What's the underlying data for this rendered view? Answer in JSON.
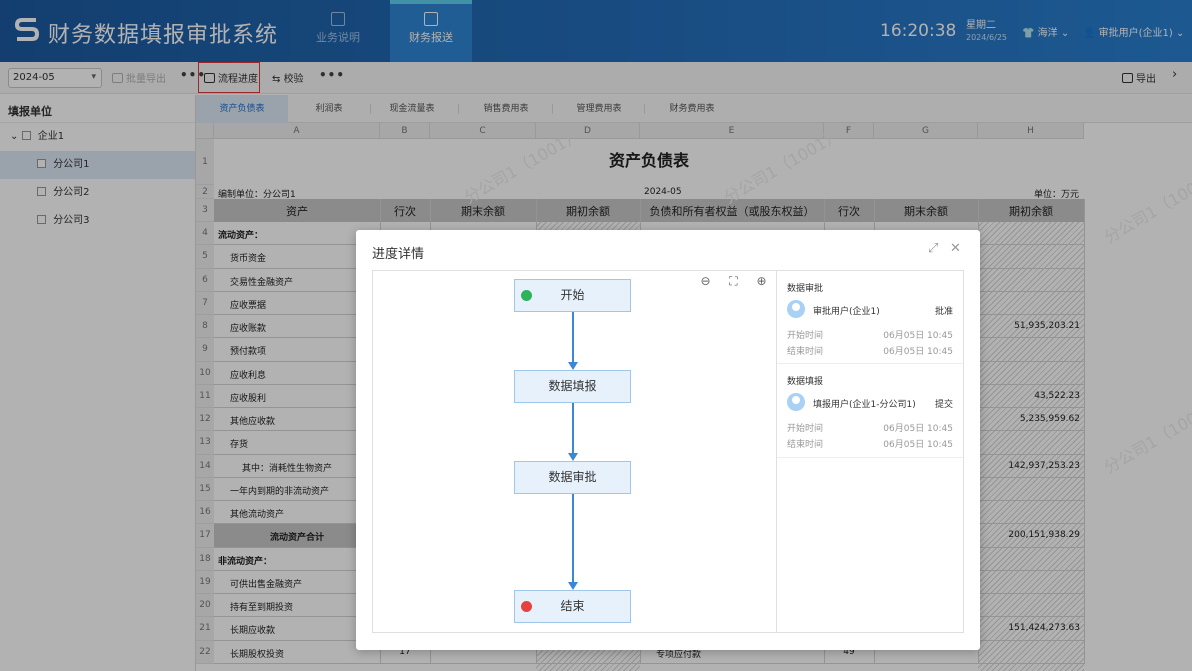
{
  "header": {
    "title": "财务数据填报审批系统",
    "nav": [
      "业务说明",
      "财务报送"
    ],
    "clock": "16:20:38",
    "weekday": "星期二",
    "date": "2024/6/25",
    "theme_label": "海洋",
    "user": "审批用户(企业1)",
    "brand_color": "#1c5aa0"
  },
  "toolbar": {
    "period": "2024-05",
    "batch_export": "批量导出",
    "flow_progress": "流程进度",
    "check": "校验",
    "export": "导出"
  },
  "sidebar": {
    "title": "填报单位",
    "items": [
      {
        "label": "企业1"
      },
      {
        "label": "分公司1"
      },
      {
        "label": "分公司2"
      },
      {
        "label": "分公司3"
      }
    ]
  },
  "sheet_tabs": [
    "资产负债表",
    "利润表",
    "现金流量表",
    "销售费用表",
    "管理费用表",
    "财务费用表"
  ],
  "sheet": {
    "columns": [
      "A",
      "B",
      "C",
      "D",
      "E",
      "F",
      "G",
      "H"
    ],
    "title": "资产负债表",
    "unit_left": "编制单位：分公司1",
    "period": "2024-05",
    "unit_right": "单位：万元",
    "header_cells": [
      "资产",
      "行次",
      "期末余额",
      "期初余额",
      "负债和所有者权益（或股东权益）",
      "行次",
      "期末余额",
      "期初余额"
    ],
    "rows": [
      {
        "num": "4",
        "a": "流动资产：",
        "h": ""
      },
      {
        "num": "5",
        "a": "货币资金",
        "h": ""
      },
      {
        "num": "6",
        "a": "交易性金融资产",
        "h": ""
      },
      {
        "num": "7",
        "a": "应收票据",
        "h": ""
      },
      {
        "num": "8",
        "a": "应收账款",
        "h": "51,935,203.21"
      },
      {
        "num": "9",
        "a": "预付款项",
        "h": ""
      },
      {
        "num": "10",
        "a": "应收利息",
        "h": ""
      },
      {
        "num": "11",
        "a": "应收股利",
        "h": "43,522.23"
      },
      {
        "num": "12",
        "a": "其他应收款",
        "h": "5,235,959.62"
      },
      {
        "num": "13",
        "a": "存货",
        "h": ""
      },
      {
        "num": "14",
        "a": "其中：消耗性生物资产",
        "h": "142,937,253.23"
      },
      {
        "num": "15",
        "a": "一年内到期的非流动资产",
        "h": ""
      },
      {
        "num": "16",
        "a": "其他流动资产",
        "h": ""
      },
      {
        "num": "17",
        "a": "流动资产合计",
        "h": "200,151,938.29"
      },
      {
        "num": "18",
        "a": "非流动资产：",
        "h": ""
      },
      {
        "num": "19",
        "a": "可供出售金融资产",
        "h": ""
      },
      {
        "num": "20",
        "a": "持有至到期投资",
        "h": ""
      },
      {
        "num": "21",
        "a": "长期应收款",
        "h": "151,424,273.63"
      },
      {
        "num": "22",
        "a": "长期股权投资",
        "b": "17",
        "e": "专项应付款",
        "f": "49",
        "h": ""
      }
    ],
    "watermark": "分公司1（1001）"
  },
  "modal": {
    "title": "进度详情",
    "flow_nodes": [
      "开始",
      "数据填报",
      "数据审批",
      "结束"
    ],
    "records": [
      {
        "step": "数据审批",
        "user": "审批用户(企业1)",
        "action": "批准",
        "start_label": "开始时间",
        "start": "06月05日 10:45",
        "end_label": "结束时间",
        "end": "06月05日 10:45"
      },
      {
        "step": "数据填报",
        "user": "填报用户(企业1-分公司1)",
        "action": "提交",
        "start_label": "开始时间",
        "start": "06月05日 10:45",
        "end_label": "结束时间",
        "end": "06月05日 10:45"
      }
    ]
  }
}
